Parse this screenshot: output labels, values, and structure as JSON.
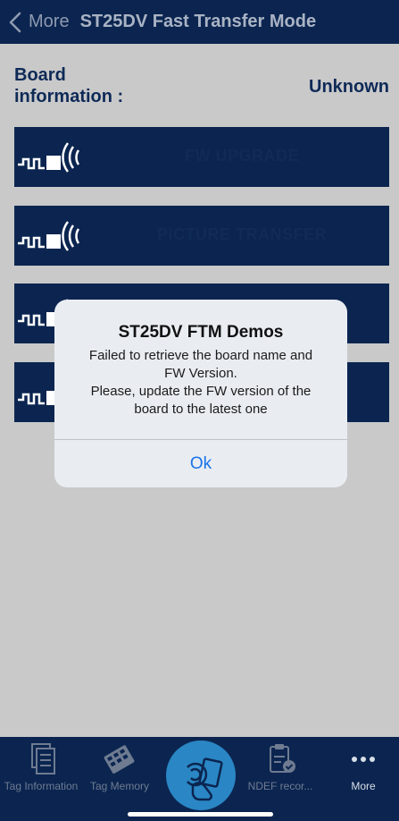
{
  "nav": {
    "back_label": "More",
    "title": "ST25DV Fast Transfer Mode"
  },
  "board": {
    "label": "Board information :",
    "value": "Unknown"
  },
  "demos": [
    {
      "label": "FW UPGRADE"
    },
    {
      "label": "PICTURE TRANSFER"
    },
    {
      "label": ""
    },
    {
      "label": ""
    }
  ],
  "alert": {
    "title": "ST25DV FTM Demos",
    "message_line1": "Failed to retrieve the board name and",
    "message_line2": "FW Version.",
    "message_line3": "Please, update the FW version of the",
    "message_line4": "board to the latest one",
    "ok_label": "Ok"
  },
  "tabs": {
    "tag_information": "Tag Information",
    "tag_memory": "Tag Memory",
    "ndef_records": "NDEF recor...",
    "more": "More"
  },
  "colors": {
    "navy": "#0b2550",
    "alert_bg": "#e9edf2",
    "ok_blue": "#1a73e8",
    "center_blue": "#2a86c4"
  }
}
